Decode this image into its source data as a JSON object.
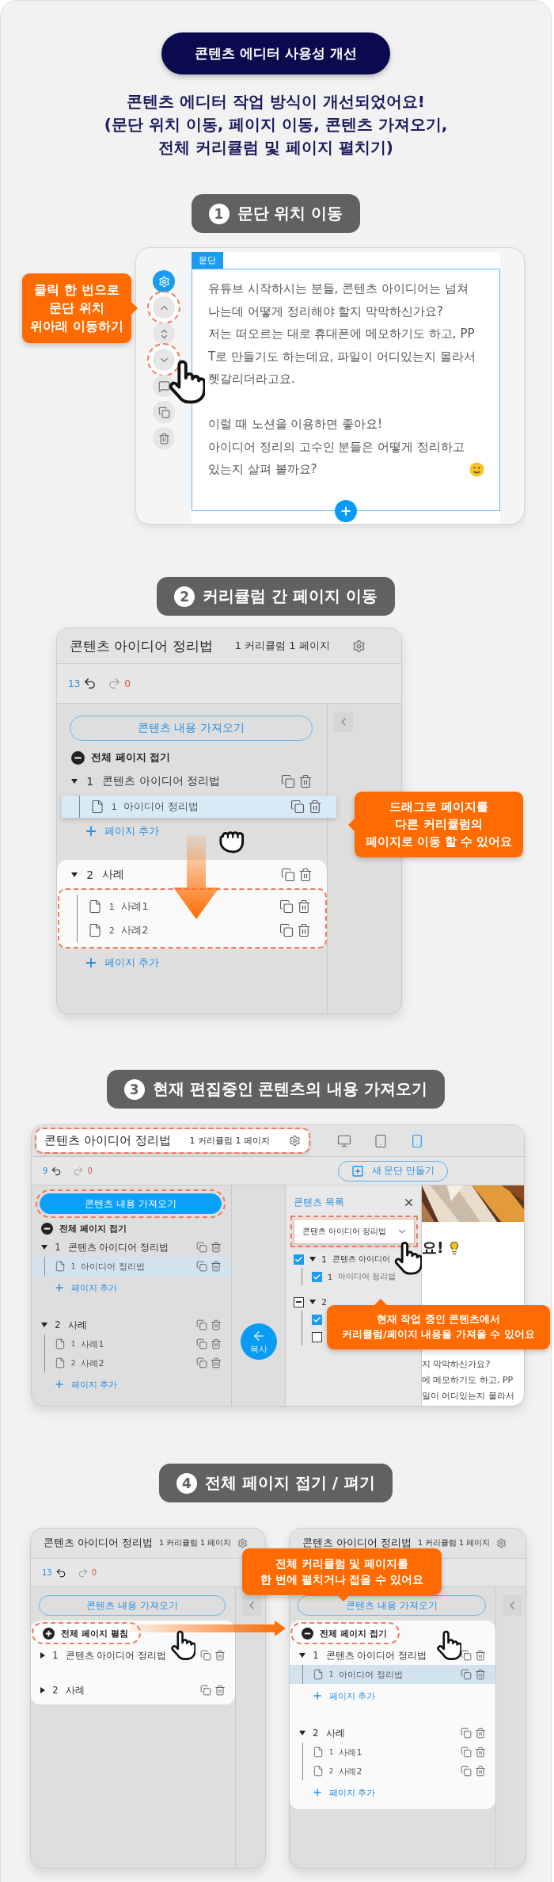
{
  "badge": "콘텐츠 에디터 사용성 개선",
  "intro": [
    "콘텐츠 에디터 작업 방식이 개선되었어요!",
    "(문단 위치 이동, 페이지 이동, 콘텐츠 가져오기,",
    "전체 커리큘럼 및 페이지 펼치기)"
  ],
  "sections": [
    {
      "kind": "paragraph-move",
      "number": "1",
      "title": "문단 위치 이동",
      "callout": [
        "클릭 한 번으로",
        "문단 위치",
        "위아래 이동하기"
      ],
      "tools": [
        {
          "kind": "settings",
          "selected": true,
          "highlighted": false
        },
        {
          "kind": "up",
          "selected": false,
          "highlighted": true
        },
        {
          "kind": "updown",
          "selected": false,
          "highlighted": false
        },
        {
          "kind": "down",
          "selected": false,
          "highlighted": true
        },
        {
          "kind": "comment",
          "selected": false,
          "highlighted": false
        },
        {
          "kind": "copy",
          "selected": false,
          "highlighted": false
        },
        {
          "kind": "delete",
          "selected": false,
          "highlighted": false
        }
      ],
      "editor": {
        "tag": "문단",
        "paragraphs": [
          [
            "유튜브 시작하시는 분들, 콘텐츠 아이디어는 넘쳐",
            "나는데 어떻게 정리해야 할지 막막하신가요?",
            "저는 떠오르는 대로 휴대폰에 메모하기도 하고, PP",
            "T로 만들기도 하는데요, 파일이 어디있는지 몰라서",
            "헷갈리더라고요."
          ],
          [
            "이럴 때 노션을 이용하면 좋아요!",
            "아이디어 정리의 고수인 분들은 어떻게 정리하고",
            "있는지 살펴 볼까요?"
          ]
        ]
      }
    },
    {
      "kind": "page-move",
      "number": "2",
      "title": "커리큘럼 간 페이지 이동",
      "callout": [
        "드래그로 페이지를",
        "다른 커리큘럼의",
        "페이지로 이동 할 수 있어요"
      ],
      "panel": {
        "title": "콘텐츠 아이디어 정리법",
        "meta": "1 커리큘럼 1 페이지",
        "title_highlighted": false,
        "undo": "13",
        "redo": "0",
        "import_button": {
          "label": "콘텐츠 내용 가져오기",
          "selected": false,
          "highlighted": false
        },
        "toggle_all": {
          "label": "전체 페이지 접기",
          "expanded": true,
          "highlighted": false
        },
        "curricula": [
          {
            "number": "1",
            "title": "콘텐츠 아이디어 정리법",
            "expanded": true,
            "highlighted": false,
            "pages": [
              {
                "number": "1",
                "title": "아이디어 정리법",
                "selected": false,
                "dragging": true
              }
            ],
            "add_page": "페이지 추가"
          },
          {
            "number": "2",
            "title": "사례",
            "expanded": true,
            "highlighted": true,
            "pages": [
              {
                "number": "1",
                "title": "사례1",
                "selected": false,
                "dragging": false
              },
              {
                "number": "2",
                "title": "사례2",
                "selected": false,
                "dragging": false
              }
            ],
            "add_page": "페이지 추가"
          }
        ]
      }
    },
    {
      "kind": "content-import",
      "number": "3",
      "title": "현재 편집중인 콘텐츠의 내용 가져오기",
      "callout": [
        "현재 작업 중인 콘텐츠에서",
        "커리큘럼/페이지 내용을 가져올 수 있어요"
      ],
      "panel": {
        "title": "콘텐츠 아이디어 정리법",
        "meta": "1 커리큘럼 1 페이지",
        "title_highlighted": true,
        "devices": [
          {
            "kind": "desktop",
            "selected": false
          },
          {
            "kind": "tablet",
            "selected": false
          },
          {
            "kind": "mobile",
            "selected": true
          }
        ],
        "undo": "9",
        "redo": "0",
        "new_paragraph": "새 문단 만들기",
        "import_button": {
          "label": "콘텐츠 내용 가져오기",
          "selected": true,
          "highlighted": true
        },
        "toggle_all": {
          "label": "전체 페이지 접기",
          "expanded": true,
          "highlighted": false
        },
        "curricula": [
          {
            "number": "1",
            "title": "콘텐츠 아이디어 정리법",
            "expanded": true,
            "highlighted": false,
            "pages": [
              {
                "number": "1",
                "title": "아이디어 정리법",
                "selected": true,
                "dragging": false
              }
            ],
            "add_page": "페이지 추가"
          },
          {
            "number": "2",
            "title": "사례",
            "expanded": true,
            "highlighted": false,
            "pages": [
              {
                "number": "1",
                "title": "사례1",
                "selected": false,
                "dragging": false
              },
              {
                "number": "2",
                "title": "사례2",
                "selected": false,
                "dragging": false
              }
            ],
            "add_page": "페이지 추가"
          }
        ]
      },
      "copy_button": "복사",
      "content_list": {
        "title": "콘텐츠 목록",
        "dropdown": {
          "value": "콘텐츠 아이디어 정리법",
          "highlighted": true
        },
        "items": [
          {
            "checked": true,
            "indeterminate": false,
            "expanded": true,
            "number": "1",
            "title": "콘텐츠 아이디어",
            "children": [
              {
                "checked": true,
                "indeterminate": false,
                "number": "1",
                "title": "아이디어 정리법"
              }
            ]
          },
          {
            "checked": false,
            "indeterminate": true,
            "expanded": true,
            "number": "2",
            "children": [
              {
                "checked": true,
                "indeterminate": false
              },
              {
                "checked": false,
                "indeterminate": false
              }
            ]
          }
        ]
      },
      "preview": {
        "heading": "요!",
        "lines": [
          "지 막막하신가요?",
          "에 메모하기도 하고, PP",
          "일이 어디있는지 몰라서"
        ]
      }
    },
    {
      "kind": "toggle-all",
      "number": "4",
      "title": "전체 페이지 접기 / 펴기",
      "callout": [
        "전체 커리큘럼 및 페이지를",
        "한 번에 펼치거나 접을 수 있어요"
      ],
      "panels": [
        {
          "title": "콘텐츠 아이디어 정리법",
          "meta": "1 커리큘럼 1 페이지",
          "title_highlighted": false,
          "undo": "13",
          "redo": "0",
          "import_button": {
            "label": "콘텐츠 내용 가져오기",
            "selected": false,
            "highlighted": false
          },
          "toggle_all": {
            "label": "전체 페이지 펼침",
            "expanded": false,
            "highlighted": true
          },
          "curricula": [
            {
              "number": "1",
              "title": "콘텐츠 아이디어 정리법",
              "expanded": false,
              "highlighted": false
            },
            {
              "number": "2",
              "title": "사례",
              "expanded": false,
              "highlighted": false
            }
          ]
        },
        {
          "title": "콘텐츠 아이디어 정리법",
          "meta": "1 커리큘럼 1 페이지",
          "title_highlighted": false,
          "import_button": {
            "label": "콘텐츠 내용 가져오기",
            "selected": false,
            "highlighted": false
          },
          "toggle_all": {
            "label": "전체 페이지 접기",
            "expanded": true,
            "highlighted": true
          },
          "curricula": [
            {
              "number": "1",
              "title": "콘텐츠 아이디어 정리법",
              "expanded": true,
              "highlighted": false,
              "pages": [
                {
                  "number": "1",
                  "title": "아이디어 정리법",
                  "selected": true,
                  "dragging": false
                }
              ],
              "add_page": "페이지 추가"
            },
            {
              "number": "2",
              "title": "사례",
              "expanded": true,
              "highlighted": false,
              "pages": [
                {
                  "number": "1",
                  "title": "사례1",
                  "selected": false,
                  "dragging": false
                },
                {
                  "number": "2",
                  "title": "사례2",
                  "selected": false,
                  "dragging": false
                }
              ],
              "add_page": "페이지 추가"
            }
          ]
        }
      ]
    }
  ]
}
